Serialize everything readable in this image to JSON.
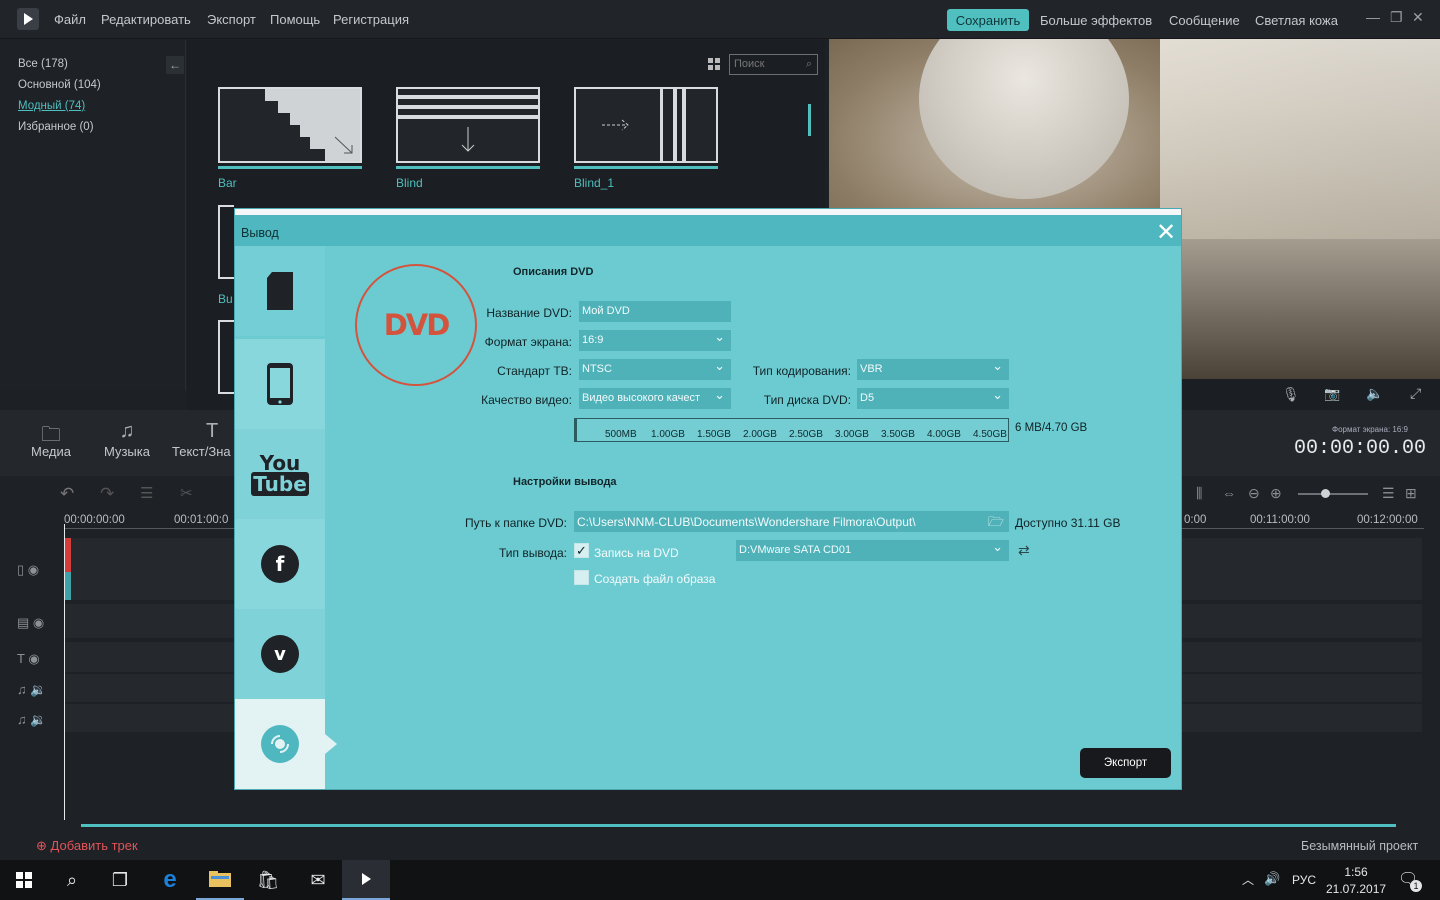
{
  "menu": [
    "Файл",
    "Редактировать",
    "Экспорт",
    "Помощь",
    "Регистрация"
  ],
  "header": {
    "save": "Сохранить",
    "more_effects": "Больше эффектов",
    "message": "Сообщение",
    "skin": "Светлая кожа"
  },
  "categories": [
    "Все (178)",
    "Основной (104)",
    "Модный (74)",
    "Избранное (0)"
  ],
  "search_placeholder": "Поиск",
  "effects": [
    {
      "label": "Bar"
    },
    {
      "label": "Blind"
    },
    {
      "label": "Blind_1"
    },
    {
      "label": "Bu"
    }
  ],
  "tools": [
    {
      "label": "Медиа",
      "icon": "folder-icon"
    },
    {
      "label": "Музыка",
      "icon": "music-icon"
    },
    {
      "label": "Текст/Зна",
      "icon": "text-icon"
    }
  ],
  "preview": {
    "aspect": "Формат экрана: 16:9",
    "timecode": "00:00:00.00"
  },
  "timeline": {
    "ruler": [
      "00:00:00:00",
      "00:01:00:0",
      "0:00",
      "00:11:00:00",
      "00:12:00:00"
    ],
    "add_track": "Добавить трек",
    "project": "Безымянный проект"
  },
  "dialog": {
    "title": "Вывод",
    "dvd_logo": "DVD",
    "section_desc": "Описания DVD",
    "name_label": "Название DVD:",
    "name_value": "Мой DVD",
    "aspect_label": "Формат экрана:",
    "aspect_value": "16:9",
    "tv_label": "Стандарт ТВ:",
    "tv_value": "NTSC",
    "encoding_label": "Тип кодирования:",
    "encoding_value": "VBR",
    "quality_label": "Качество видео:",
    "quality_value": "Видео высокого качест",
    "disc_label": "Тип диска DVD:",
    "disc_value": "D5",
    "scale_ticks": [
      "500MB",
      "1.00GB",
      "1.50GB",
      "2.00GB",
      "2.50GB",
      "3.00GB",
      "3.50GB",
      "4.00GB",
      "4.50GB"
    ],
    "size_info": "6 MB/4.70 GB",
    "section_output": "Настройки вывода",
    "path_label": "Путь к папке DVD:",
    "path_value": "C:\\Users\\NNM-CLUB\\Documents\\Wondershare Filmora\\Output\\",
    "available": "Доступно 31.11 GB",
    "output_type_label": "Тип вывода:",
    "burn_dvd": "Запись на DVD",
    "burn_checked": true,
    "drive_value": "D:VMware SATA CD01",
    "create_iso": "Создать файл образа",
    "iso_checked": false,
    "export": "Экспорт"
  },
  "taskbar": {
    "lang": "РУС",
    "time": "1:56",
    "date": "21.07.2017",
    "notifications": "1"
  }
}
